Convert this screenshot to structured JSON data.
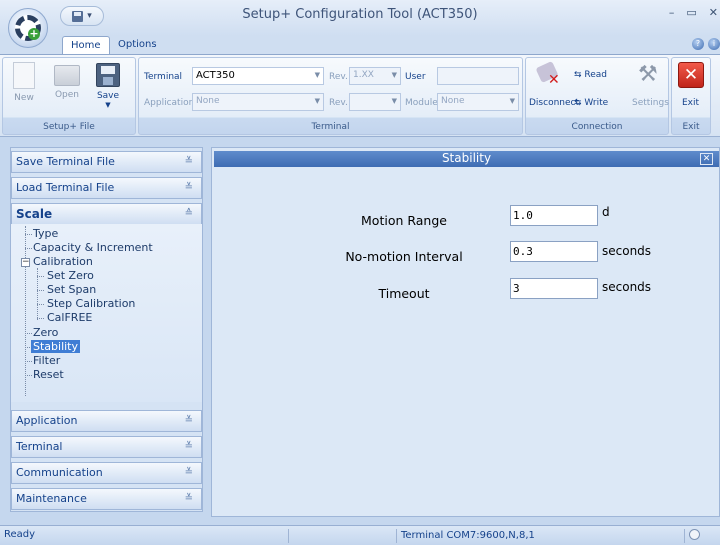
{
  "window": {
    "title": "Setup+ Configuration Tool (ACT350)",
    "controls": [
      "–",
      "▭",
      "✕"
    ]
  },
  "tabs": [
    {
      "label": "Home",
      "active": true
    },
    {
      "label": "Options",
      "active": false
    }
  ],
  "ribbon": {
    "setup_file": {
      "group_label": "Setup+ File",
      "new_label": "New",
      "open_label": "Open",
      "save_label": "Save"
    },
    "terminal": {
      "group_label": "Terminal",
      "terminal_label": "Terminal",
      "terminal_value": "ACT350",
      "rev_label": "Rev.",
      "rev_value": "1.XX",
      "user_label": "User",
      "user_value": "",
      "application_label": "Application",
      "application_value": "None",
      "rev2_label": "Rev.",
      "rev2_value": "",
      "module_label": "Module",
      "module_value": "None"
    },
    "connection": {
      "group_label": "Connection",
      "disconnect_label": "Disconnect",
      "read_label": "Read",
      "write_label": "Write",
      "settings_label": "Settings"
    },
    "exit": {
      "group_label": "Exit",
      "exit_label": "Exit"
    }
  },
  "leftnav": {
    "save_terminal_file": "Save Terminal File",
    "load_terminal_file": "Load Terminal File",
    "scale": "Scale",
    "scale_items": {
      "type": "Type",
      "capacity": "Capacity & Increment",
      "calibration": "Calibration",
      "set_zero": "Set Zero",
      "set_span": "Set Span",
      "step_calibration": "Step Calibration",
      "calfree": "CalFREE",
      "zero": "Zero",
      "stability": "Stability",
      "filter": "Filter",
      "reset": "Reset"
    },
    "application": "Application",
    "terminal": "Terminal",
    "communication": "Communication",
    "maintenance": "Maintenance",
    "collapsed_chevron": "≚",
    "expanded_chevron": "≙"
  },
  "main": {
    "title": "Stability",
    "close": "✕",
    "fields": [
      {
        "label": "Motion Range",
        "value": "1.0",
        "unit": "d"
      },
      {
        "label": "No-motion Interval",
        "value": "0.3",
        "unit": "seconds"
      },
      {
        "label": "Timeout",
        "value": "3",
        "unit": "seconds"
      }
    ]
  },
  "status": {
    "ready": "Ready",
    "terminal_label": "Terminal",
    "port": "COM7:9600,N,8,1"
  }
}
